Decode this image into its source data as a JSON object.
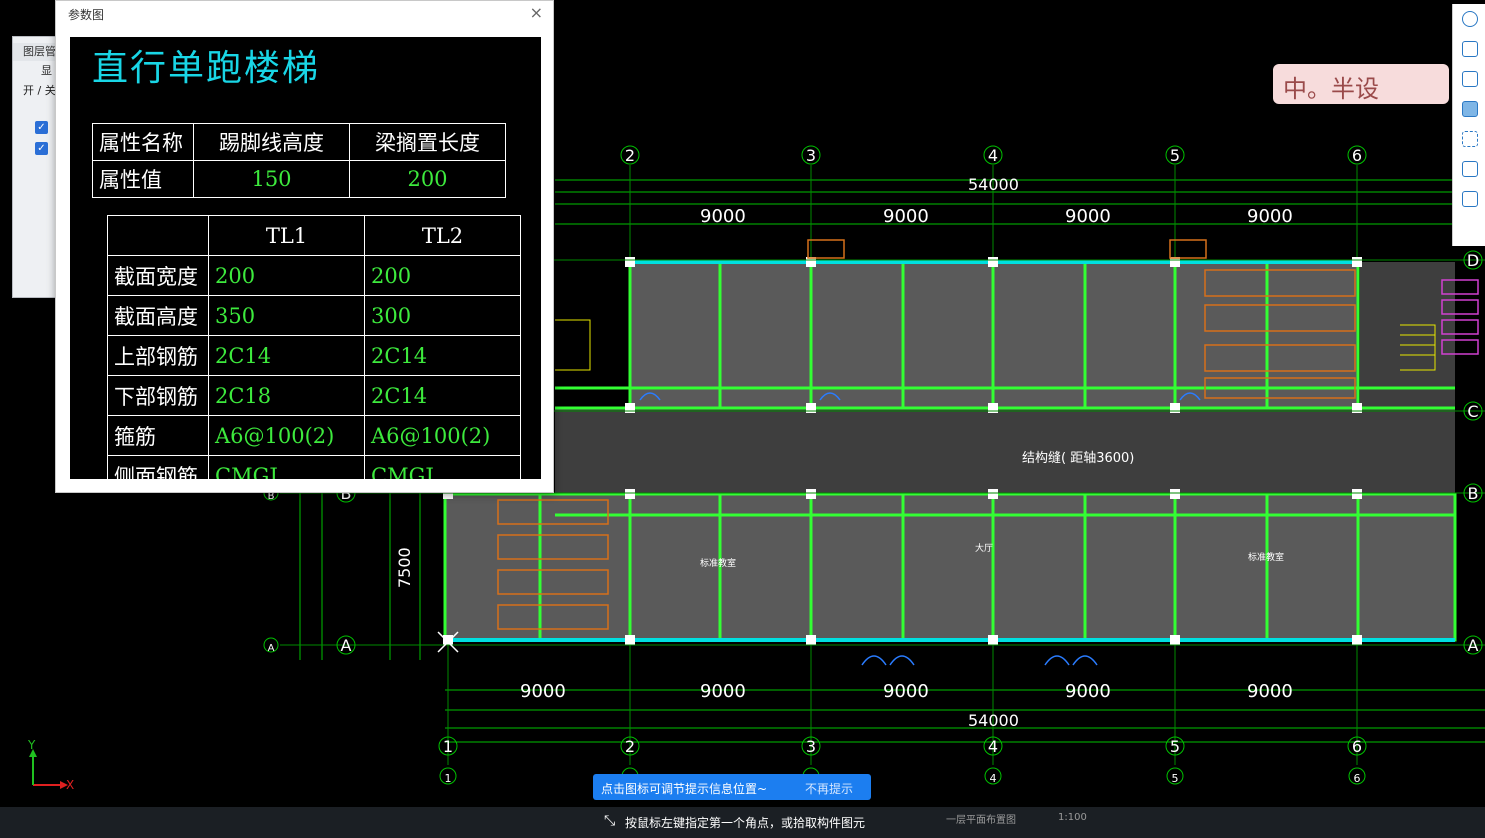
{
  "dialog": {
    "title": "参数图",
    "close_glyph": "×",
    "drawing_title": "直行单跑楼梯",
    "attr_table": {
      "rows": [
        [
          "属性名称",
          "踢脚线高度",
          "梁搁置长度"
        ],
        [
          "属性值",
          "150",
          "200"
        ]
      ]
    },
    "beam_table": {
      "header": [
        "",
        "TL1",
        "TL2"
      ],
      "rows": [
        [
          "截面宽度",
          "200",
          "200"
        ],
        [
          "截面高度",
          "350",
          "300"
        ],
        [
          "上部钢筋",
          "2C14",
          "2C14"
        ],
        [
          "下部钢筋",
          "2C18",
          "2C14"
        ],
        [
          "箍筋",
          "A6@100(2)",
          "A6@100(2)"
        ],
        [
          "侧面钢筋",
          "CMGJ",
          "CMGJ"
        ]
      ]
    }
  },
  "layer_panel": {
    "header": "图层管",
    "row1": "显",
    "row2": "开 / 关"
  },
  "sticker": {
    "text": "中。半设"
  },
  "hint": {
    "message": "点击图标可调节提示信息位置~",
    "dismiss": "不再提示"
  },
  "status": {
    "prompt": "按鼠标左键指定第一个角点，或拾取构件图元",
    "sheet_name": "一层平面布置图",
    "scale": "1:100"
  },
  "cad": {
    "axis_numbers": [
      "1",
      "2",
      "3",
      "4",
      "5",
      "6"
    ],
    "axis_letters": [
      "A",
      "B",
      "C",
      "D"
    ],
    "total_dim": "54000",
    "bay_dim": "9000",
    "depth_dim": "7500",
    "gap_label": "结构缝( 距轴3600)",
    "room_label": "标准教室",
    "hall_label": "大厅"
  },
  "colors": {
    "axis": "#00c000",
    "wall": "#33ff33",
    "floor": "#5a5a5a",
    "highlight": "#00e0e0",
    "annot": "#d80000"
  }
}
